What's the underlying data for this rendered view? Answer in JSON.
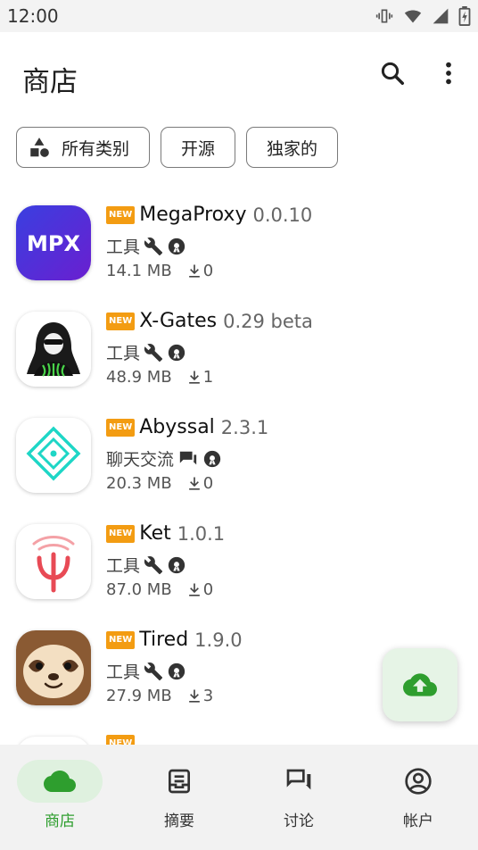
{
  "status_bar": {
    "time": "12:00"
  },
  "app_bar": {
    "title": "商店"
  },
  "chips": [
    {
      "label": "所有类别",
      "icon": "category-shapes-icon"
    },
    {
      "label": "开源"
    },
    {
      "label": "独家的"
    }
  ],
  "badge_new": "NEW",
  "apps": [
    {
      "name": "MegaProxy",
      "version": "0.0.10",
      "category": "工具",
      "category_icon": "wrench-icon",
      "size": "14.1 MB",
      "downloads": "0",
      "icon_text": "MPX"
    },
    {
      "name": "X-Gates",
      "version": "0.29 beta",
      "category": "工具",
      "category_icon": "wrench-icon",
      "size": "48.9 MB",
      "downloads": "1"
    },
    {
      "name": "Abyssal",
      "version": "2.3.1",
      "category": "聊天交流",
      "category_icon": "chat-icon",
      "size": "20.3 MB",
      "downloads": "0"
    },
    {
      "name": "Ket",
      "version": "1.0.1",
      "category": "工具",
      "category_icon": "wrench-icon",
      "size": "87.0 MB",
      "downloads": "0"
    },
    {
      "name": "Tired",
      "version": "1.9.0",
      "category": "工具",
      "category_icon": "wrench-icon",
      "size": "27.9 MB",
      "downloads": "3"
    }
  ],
  "bottom_nav": [
    {
      "label": "商店",
      "icon": "cloud-icon",
      "active": true
    },
    {
      "label": "摘要",
      "icon": "feed-icon"
    },
    {
      "label": "讨论",
      "icon": "forum-icon"
    },
    {
      "label": "帐户",
      "icon": "account-icon"
    }
  ],
  "colors": {
    "accent": "#2e9e2e",
    "badge": "#f39c12",
    "nav_bg": "#f2f2f2"
  }
}
